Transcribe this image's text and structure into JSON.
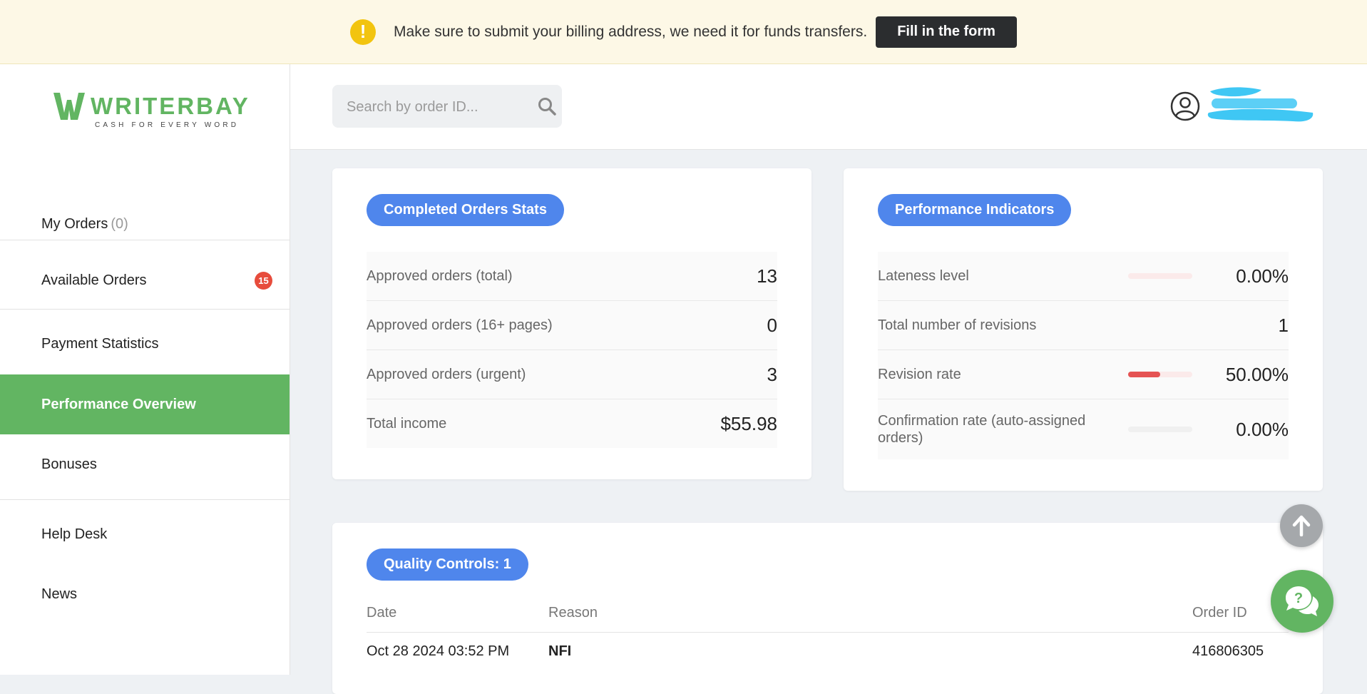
{
  "notice": {
    "text": "Make sure to submit your billing address, we need it for funds transfers.",
    "button": "Fill in the form"
  },
  "logo": {
    "name": "WRITERBAY",
    "tagline": "CASH FOR EVERY WORD"
  },
  "sidebar": {
    "items": [
      {
        "label": "My Orders",
        "count": "(0)"
      },
      {
        "label": "Available Orders",
        "badge": "15"
      },
      {
        "label": "Payment Statistics"
      },
      {
        "label": "Performance Overview"
      },
      {
        "label": "Bonuses"
      },
      {
        "label": "Help Desk"
      },
      {
        "label": "News"
      }
    ]
  },
  "search": {
    "placeholder": "Search by order ID..."
  },
  "completed": {
    "title": "Completed Orders Stats",
    "rows": [
      {
        "label": "Approved orders (total)",
        "value": "13"
      },
      {
        "label": "Approved orders (16+ pages)",
        "value": "0"
      },
      {
        "label": "Approved orders (urgent)",
        "value": "3"
      },
      {
        "label": "Total income",
        "value": "$55.98"
      }
    ]
  },
  "performance": {
    "title": "Performance Indicators",
    "rows": [
      {
        "label": "Lateness level",
        "value": "0.00%",
        "bar": 0.0
      },
      {
        "label": "Total number of revisions",
        "value": "1"
      },
      {
        "label": "Revision rate",
        "value": "50.00%",
        "bar": 0.5
      },
      {
        "label": "Confirmation rate (auto-assigned orders)",
        "value": "0.00%",
        "bar": 0.0
      }
    ]
  },
  "quality": {
    "title": "Quality Controls: 1",
    "headers": {
      "date": "Date",
      "reason": "Reason",
      "order_id": "Order ID"
    },
    "rows": [
      {
        "date": "Oct 28 2024 03:52 PM",
        "reason": "NFI",
        "order_id": "416806305"
      }
    ]
  },
  "colors": {
    "brand_green": "#62b562",
    "pill_blue": "#4f86ec",
    "alert_red": "#e55353",
    "notice_bg": "#fdf8e6"
  },
  "icons": [
    "exclamation-icon",
    "search-icon",
    "user-circle-icon",
    "arrow-up-icon",
    "help-chat-icon"
  ]
}
